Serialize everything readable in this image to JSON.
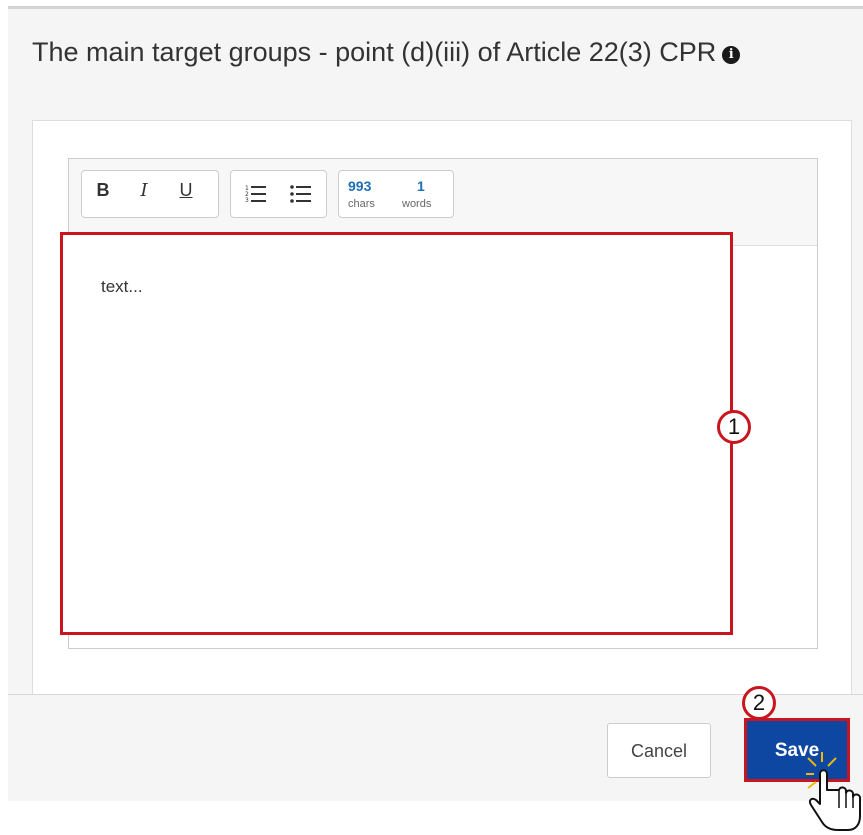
{
  "dialog": {
    "title": "The main target groups - point (d)(iii) of Article 22(3) CPR",
    "info_icon_glyph": "i"
  },
  "toolbar": {
    "bold": "B",
    "italic": "I",
    "underline": "U",
    "chars_count": "993",
    "chars_label": "chars",
    "words_count": "1",
    "words_label": "words"
  },
  "editor": {
    "text": "text..."
  },
  "callouts": {
    "first": "1",
    "second": "2"
  },
  "footer": {
    "cancel_label": "Cancel",
    "save_label": "Save"
  },
  "colors": {
    "highlight_red": "#c9151e",
    "save_blue": "#0e47a1",
    "counter_blue": "#1f6fb5"
  },
  "icons": [
    "info-icon",
    "ordered-list-icon",
    "bullet-list-icon",
    "hand-pointer-icon"
  ]
}
